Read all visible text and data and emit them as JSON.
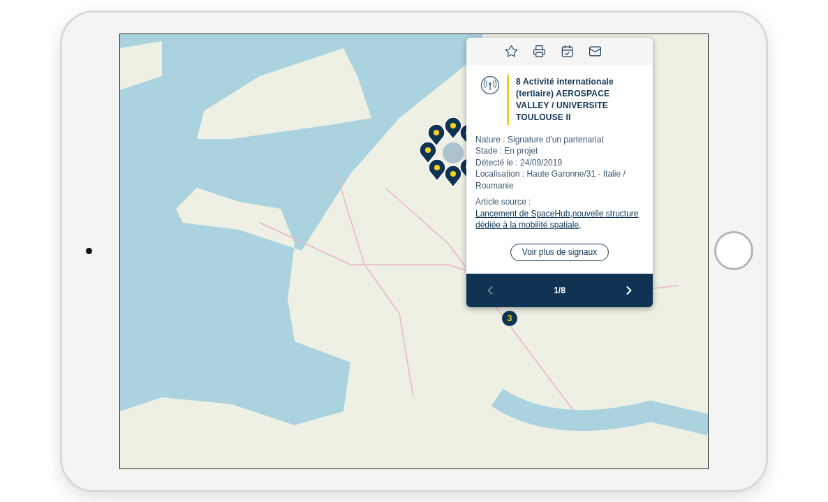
{
  "map": {
    "cluster_count": "3"
  },
  "popup": {
    "title": "8 Activité internationale (tertiaire) AEROSPACE VALLEY / UNIVERSITE TOULOUSE II",
    "details": [
      "Nature : Signature d'un partenariat",
      "Stade : En projet",
      "Détecté le : 24/09/2019",
      "Localisation : Haute Garonne/31 - Italie / Roumanie"
    ],
    "source_label": "Article source :",
    "source_link": "Lancement de SpaceHub,nouvelle structure dédiée à la mobilité spatiale,",
    "more_button": "Voir plus de signaux",
    "pager": {
      "prev_disabled": true,
      "label": "1/8",
      "next_disabled": false
    }
  }
}
